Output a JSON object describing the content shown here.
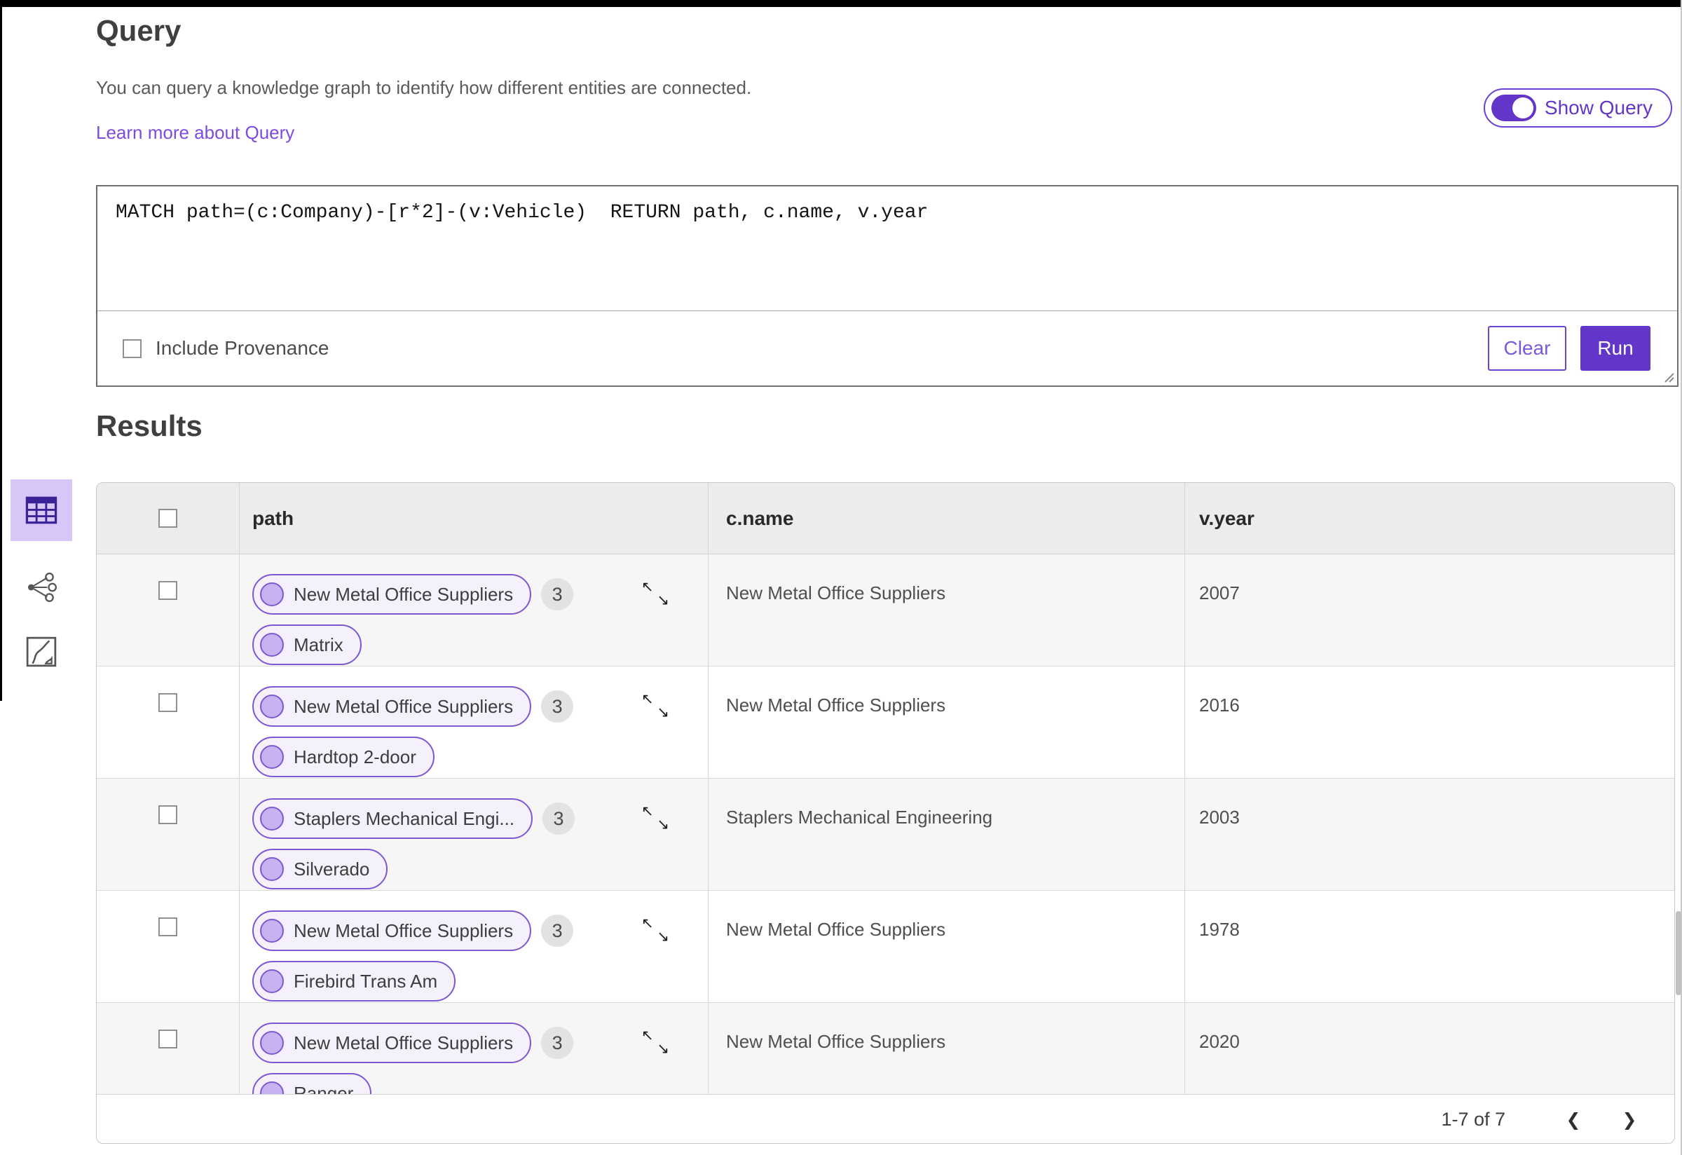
{
  "header": {
    "title": "Query",
    "description": "You can query a knowledge graph to identify how different entities are connected.",
    "learn_more_link": "Learn more about Query",
    "show_query": {
      "label": "Show Query",
      "state": "on"
    }
  },
  "query_editor": {
    "text": "MATCH path=(c:Company)-[r*2]-(v:Vehicle)  RETURN path, c.name, v.year",
    "include_provenance": {
      "label": "Include Provenance",
      "checked": false
    },
    "buttons": {
      "clear": "Clear",
      "run": "Run"
    }
  },
  "results": {
    "title": "Results",
    "view_switcher": [
      {
        "icon": "table-view-icon",
        "selected": true
      },
      {
        "icon": "graph-view-icon",
        "selected": false
      },
      {
        "icon": "map-view-icon",
        "selected": false
      }
    ],
    "table": {
      "columns": [
        "path",
        "c.name",
        "v.year"
      ],
      "rows": [
        {
          "path": [
            {
              "label": "New Metal Office Suppliers",
              "badge": "3"
            },
            {
              "label": "Matrix"
            }
          ],
          "c_name": "New Metal Office Suppliers",
          "v_year": "2007"
        },
        {
          "path": [
            {
              "label": "New Metal Office Suppliers",
              "badge": "3"
            },
            {
              "label": "Hardtop 2-door"
            }
          ],
          "c_name": "New Metal Office Suppliers",
          "v_year": "2016"
        },
        {
          "path": [
            {
              "label": "Staplers Mechanical Engi...",
              "badge": "3"
            },
            {
              "label": "Silverado"
            }
          ],
          "c_name": "Staplers Mechanical Engineering",
          "v_year": "2003"
        },
        {
          "path": [
            {
              "label": "New Metal Office Suppliers",
              "badge": "3"
            },
            {
              "label": "Firebird Trans Am"
            }
          ],
          "c_name": "New Metal Office Suppliers",
          "v_year": "1978"
        },
        {
          "path": [
            {
              "label": "New Metal Office Suppliers",
              "badge": "3"
            },
            {
              "label": "Ranger"
            }
          ],
          "c_name": "New Metal Office Suppliers",
          "v_year": "2020"
        }
      ],
      "pagination": {
        "range_label": "1-7 of 7",
        "prev_icon": "❮",
        "next_icon": "❯"
      }
    }
  },
  "icons": {
    "expand_arrows": [
      "↖",
      "↘"
    ]
  },
  "colors": {
    "accent": "#6236c9",
    "link": "#7d4be0",
    "pill_border": "#7e57d4",
    "pill_bg": "#f5f1fc",
    "node_fill": "#c9b2f1",
    "selected_view_bg": "#d9c6f8",
    "table_header_bg": "#ececec",
    "row_alt_bg": "#f6f6f6",
    "badge_bg": "#e2e2e2"
  }
}
